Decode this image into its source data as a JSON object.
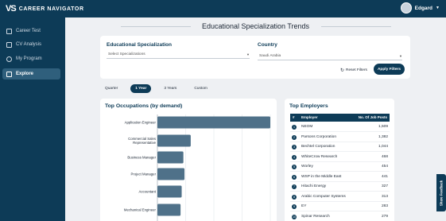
{
  "app": {
    "logo_mark": "VS",
    "name": "CAREER NAVIGATOR"
  },
  "user": {
    "name": "Edgard"
  },
  "sidebar": {
    "items": [
      {
        "label": "Career Test",
        "icon": "clipboard-icon"
      },
      {
        "label": "CV Analysis",
        "icon": "document-icon"
      },
      {
        "label": "My Program",
        "icon": "user-icon"
      },
      {
        "label": "Explore",
        "icon": "explore-icon",
        "active": true
      }
    ]
  },
  "page": {
    "title": "Educational Specialization Trends"
  },
  "filters": {
    "specialization_label": "Educational Specialization",
    "specialization_placeholder": "Select Specializations",
    "country_label": "Country",
    "country_value": "Saudi Arabia",
    "reset_label": "Reset Filters",
    "apply_label": "Apply Filters"
  },
  "period_tabs": [
    {
      "label": "Quarter"
    },
    {
      "label": "1 Year",
      "active": true
    },
    {
      "label": "3 Years"
    },
    {
      "label": "Custom"
    }
  ],
  "occupations": {
    "title": "Top Occupations (by demand)",
    "bar_color": "#4f7189"
  },
  "chart_data": {
    "type": "bar",
    "orientation": "horizontal",
    "title": "Top Occupations (by demand)",
    "categories": [
      "Application Engineer",
      "Commercial Sales Representative",
      "Business Manager",
      "Project Manager",
      "Accountant",
      "Mechanical Engineer"
    ],
    "values": [
      100,
      29.5,
      23,
      24,
      21.5,
      20.5
    ],
    "xlim": [
      0,
      100
    ],
    "grid": true
  },
  "employers": {
    "title": "Top Employers",
    "headers": {
      "rank": "#",
      "employer": "Employer",
      "posts": "No. Of Job Posts"
    },
    "rows": [
      {
        "rank": "1",
        "name": "NEOM",
        "posts": "1,509"
      },
      {
        "rank": "2",
        "name": "Parsons Corporation",
        "posts": "1,382"
      },
      {
        "rank": "3",
        "name": "Bechtel Corporation",
        "posts": "1,044"
      },
      {
        "rank": "4",
        "name": "WhiteCrow Research",
        "posts": "468"
      },
      {
        "rank": "5",
        "name": "Worley",
        "posts": "454"
      },
      {
        "rank": "6",
        "name": "WSP in the Middle East",
        "posts": "441"
      },
      {
        "rank": "7",
        "name": "Hitachi Energy",
        "posts": "327"
      },
      {
        "rank": "8",
        "name": "Arabic Computer Systems",
        "posts": "313"
      },
      {
        "rank": "9",
        "name": "EY",
        "posts": "283"
      },
      {
        "rank": "10",
        "name": "Spinar Research",
        "posts": "279"
      }
    ]
  },
  "feedback": {
    "label": "Share Feedback"
  },
  "colors": {
    "navy": "#0d3b57",
    "bar": "#4f7189",
    "background": "#eef0f3"
  }
}
